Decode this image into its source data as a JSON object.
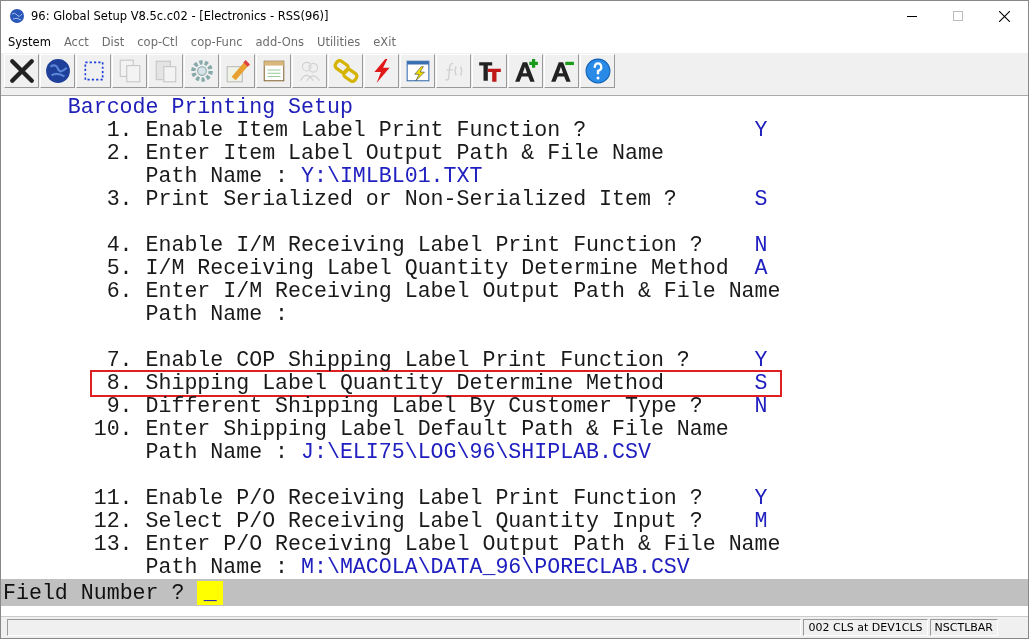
{
  "window": {
    "title": "96: Global Setup V8.5c.c02 - [Electronics - RSS(96)]"
  },
  "menu": [
    {
      "label": "System",
      "disabled": false
    },
    {
      "label": "Acct",
      "disabled": true
    },
    {
      "label": "Dist",
      "disabled": true
    },
    {
      "label": "cop-Ctl",
      "disabled": true
    },
    {
      "label": "cop-Func",
      "disabled": true
    },
    {
      "label": "add-Ons",
      "disabled": true
    },
    {
      "label": "Utilities",
      "disabled": true
    },
    {
      "label": "eXit",
      "disabled": true
    }
  ],
  "toolbar": [
    {
      "kind": "close",
      "disabled": false
    },
    {
      "kind": "globe",
      "disabled": false
    },
    {
      "kind": "select",
      "disabled": false
    },
    {
      "kind": "copy",
      "disabled": true
    },
    {
      "kind": "paste",
      "disabled": true
    },
    {
      "kind": "gear",
      "disabled": false
    },
    {
      "kind": "edit",
      "disabled": false
    },
    {
      "kind": "notepad",
      "disabled": false
    },
    {
      "kind": "people",
      "disabled": true
    },
    {
      "kind": "link",
      "disabled": false
    },
    {
      "kind": "lightning",
      "disabled": false
    },
    {
      "kind": "window-lightning",
      "disabled": false
    },
    {
      "kind": "function",
      "disabled": true
    },
    {
      "kind": "text-size",
      "disabled": false
    },
    {
      "kind": "font-grow",
      "disabled": false
    },
    {
      "kind": "font-shrink",
      "disabled": false
    },
    {
      "kind": "help",
      "disabled": false
    }
  ],
  "screen": {
    "title": "Barcode Printing Setup",
    "sections": [
      {
        "items": [
          {
            "number": "1.",
            "label": "Enable Item Label Print Function ?",
            "value": "Y",
            "highlighted": false
          },
          {
            "number": "2.",
            "label": "Enter Item Label Output Path & File Name",
            "path_label": "Path Name :",
            "path": "Y:\\IMLBL01.TXT",
            "highlighted": false
          },
          {
            "number": "3.",
            "label": "Print Serialized or Non-Serialized Item ?",
            "value": "S",
            "highlighted": false
          }
        ]
      },
      {
        "items": [
          {
            "number": "4.",
            "label": "Enable I/M Receiving Label Print Function ?",
            "value": "N",
            "highlighted": false
          },
          {
            "number": "5.",
            "label": "I/M Receiving Label Quantity Determine Method",
            "value": "A",
            "highlighted": false
          },
          {
            "number": "6.",
            "label": "Enter I/M Receiving Label Output Path & File Name",
            "path_label": "Path Name :",
            "highlighted": false
          }
        ]
      },
      {
        "items": [
          {
            "number": "7.",
            "label": "Enable COP Shipping Label Print Function ?",
            "value": "Y",
            "highlighted": false
          },
          {
            "number": "8.",
            "label": "Shipping Label Quantity Determine Method",
            "value": "S",
            "highlighted": true
          },
          {
            "number": "9.",
            "label": "Different Shipping Label By Customer Type ?",
            "value": "N",
            "highlighted": false
          },
          {
            "number": "10.",
            "label": "Enter Shipping Label Default Path & File Name",
            "path_label": "Path Name :",
            "path": "J:\\ELI75\\LOG\\96\\SHIPLAB.CSV",
            "highlighted": false
          }
        ]
      },
      {
        "items": [
          {
            "number": "11.",
            "label": "Enable P/O Receiving Label Print Function ?",
            "value": "Y",
            "highlighted": false
          },
          {
            "number": "12.",
            "label": "Select P/O Receiving Label Quantity Input ?",
            "value": "M",
            "highlighted": false
          },
          {
            "number": "13.",
            "label": "Enter P/O Receiving Label Output Path & File Name",
            "path_label": "Path Name :",
            "path": "M:\\MACOLA\\DATA_96\\PORECLAB.CSV",
            "highlighted": false
          }
        ]
      }
    ]
  },
  "prompt": {
    "label": "Field Number ?",
    "value": "_"
  },
  "status_bar": [
    "002 CLS at DEV1CLS",
    "NSCTLBAR"
  ]
}
